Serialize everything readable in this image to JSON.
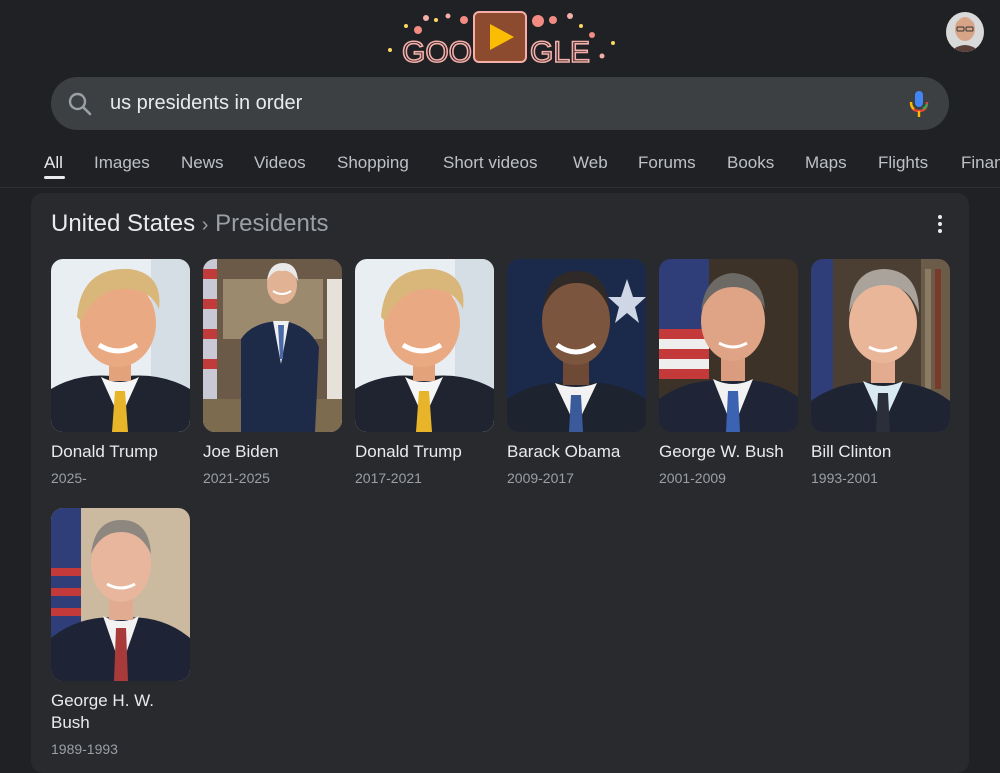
{
  "logo": {
    "text_left": "GOO",
    "text_right": "GLE"
  },
  "search": {
    "query": "us presidents in order"
  },
  "tabs": [
    {
      "label": "All",
      "active": true
    },
    {
      "label": "Images"
    },
    {
      "label": "News"
    },
    {
      "label": "Videos"
    },
    {
      "label": "Shopping"
    },
    {
      "label": "Short videos"
    },
    {
      "label": "Web"
    },
    {
      "label": "Forums"
    },
    {
      "label": "Books"
    },
    {
      "label": "Maps"
    },
    {
      "label": "Flights"
    },
    {
      "label": "Finance"
    }
  ],
  "panel": {
    "breadcrumb_root": "United States",
    "breadcrumb_separator": "›",
    "breadcrumb_current": "Presidents"
  },
  "presidents": [
    {
      "name": "Donald Trump",
      "years": "2025-"
    },
    {
      "name": "Joe Biden",
      "years": "2021-2025"
    },
    {
      "name": "Donald Trump",
      "years": "2017-2021"
    },
    {
      "name": "Barack Obama",
      "years": "2009-2017"
    },
    {
      "name": "George W. Bush",
      "years": "2001-2009"
    },
    {
      "name": "Bill Clinton",
      "years": "1993-2001"
    },
    {
      "name": "George H. W. Bush",
      "years": "1989-1993"
    }
  ],
  "colors": {
    "background": "#202124",
    "panel": "#292a2d",
    "searchbox": "#3c4043",
    "text_primary": "#e8eaed",
    "text_secondary": "#9aa0a6"
  }
}
